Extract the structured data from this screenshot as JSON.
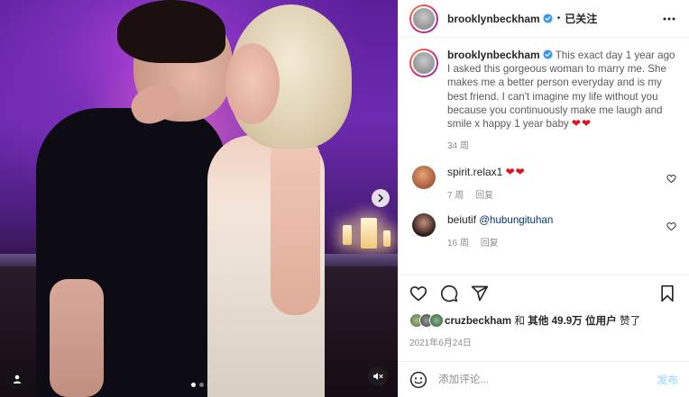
{
  "post": {
    "username": "brooklynbeckham",
    "separator": "•",
    "follow_status": "已关注",
    "caption": "This exact day 1 year ago I asked this gorgeous woman to marry me. She makes me a better person everyday and is my best friend. I can't imagine my life without you because you continuously make me laugh and smile x happy 1 year baby",
    "caption_emoji": "❤❤",
    "caption_age": "34 周",
    "likes_user": "cruzbeckham",
    "likes_and": "和",
    "likes_others": "其他 49.9万 位用户",
    "likes_suffix": "赞了",
    "date": "2021年6月24日"
  },
  "comments": [
    {
      "username": "spirit.relax1",
      "text": "❤❤",
      "age": "7 周",
      "reply": "回复"
    },
    {
      "username": "beiutif",
      "mention": "@hubungituhan",
      "age": "16 周",
      "reply": "回复"
    }
  ],
  "comment_box": {
    "placeholder": "添加评论...",
    "post_label": "发布"
  },
  "icons": {
    "verified": "verified-badge-icon",
    "more": "more-options-icon",
    "like": "heart-icon",
    "comment": "comment-icon",
    "share": "share-icon",
    "save": "bookmark-icon",
    "emoji": "emoji-icon",
    "next": "chevron-right-icon",
    "tag": "user-tag-icon",
    "mute": "muted-speaker-icon"
  },
  "colors": {
    "verified": "#3897f0",
    "heart": "#e0101c",
    "post_disabled": "#b2dffc",
    "mention": "#00376b"
  },
  "carousel": {
    "slides": 2,
    "current": 1
  }
}
